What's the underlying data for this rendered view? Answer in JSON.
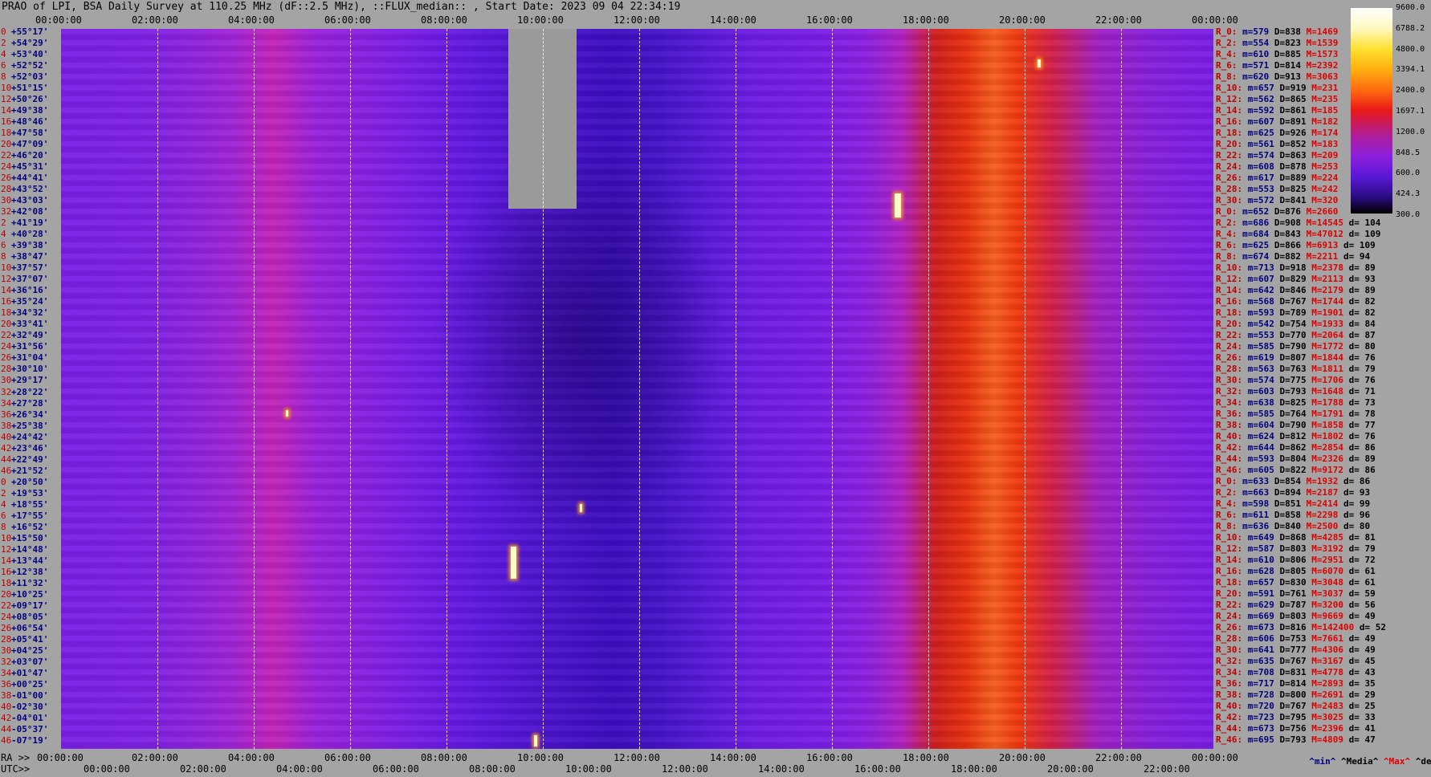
{
  "title": "PRAO of LPI, BSA Daily Survey at 110.25 MHz (dF::2.5 MHz), ::FLUX_median:: , Start Date: 2023 09 04 22:34:19",
  "top_axis": [
    "00:00:00",
    "02:00:00",
    "04:00:00",
    "06:00:00",
    "08:00:00",
    "10:00:00",
    "12:00:00",
    "14:00:00",
    "16:00:00",
    "18:00:00",
    "20:00:00",
    "22:00:00",
    "00:00:00"
  ],
  "ra_axis": {
    "prefix": "RA >>",
    "labels": [
      "00:00:00",
      "02:00:00",
      "04:00:00",
      "06:00:00",
      "08:00:00",
      "10:00:00",
      "12:00:00",
      "14:00:00",
      "16:00:00",
      "18:00:00",
      "20:00:00",
      "22:00:00",
      "00:00:00"
    ]
  },
  "utc_axis": {
    "prefix": "UTC>>",
    "labels": [
      "00:00:00",
      "02:00:00",
      "04:00:00",
      "06:00:00",
      "08:00:00",
      "10:00:00",
      "12:00:00",
      "14:00:00",
      "16:00:00",
      "18:00:00",
      "20:00:00",
      "22:00:00"
    ]
  },
  "colorbar": {
    "labels": [
      "9600.0",
      "6788.2",
      "4800.0",
      "3394.1",
      "2400.0",
      "1697.1",
      "1200.0",
      "848.5",
      "600.0",
      "424.3",
      "300.0"
    ]
  },
  "declinations": [
    {
      "i": "0",
      "dec": "+55°17'"
    },
    {
      "i": "2",
      "dec": "+54°29'"
    },
    {
      "i": "4",
      "dec": "+53°40'"
    },
    {
      "i": "6",
      "dec": "+52°52'"
    },
    {
      "i": "8",
      "dec": "+52°03'"
    },
    {
      "i": "10",
      "dec": "+51°15'"
    },
    {
      "i": "12",
      "dec": "+50°26'"
    },
    {
      "i": "14",
      "dec": "+49°38'"
    },
    {
      "i": "16",
      "dec": "+48°46'"
    },
    {
      "i": "18",
      "dec": "+47°58'"
    },
    {
      "i": "20",
      "dec": "+47°09'"
    },
    {
      "i": "22",
      "dec": "+46°20'"
    },
    {
      "i": "24",
      "dec": "+45°31'"
    },
    {
      "i": "26",
      "dec": "+44°41'"
    },
    {
      "i": "28",
      "dec": "+43°52'"
    },
    {
      "i": "30",
      "dec": "+43°03'"
    },
    {
      "i": "32",
      "dec": "+42°08'"
    },
    {
      "i": "2",
      "dec": "+41°19'"
    },
    {
      "i": "4",
      "dec": "+40°28'"
    },
    {
      "i": "6",
      "dec": "+39°38'"
    },
    {
      "i": "8",
      "dec": "+38°47'"
    },
    {
      "i": "10",
      "dec": "+37°57'"
    },
    {
      "i": "12",
      "dec": "+37°07'"
    },
    {
      "i": "14",
      "dec": "+36°16'"
    },
    {
      "i": "16",
      "dec": "+35°24'"
    },
    {
      "i": "18",
      "dec": "+34°32'"
    },
    {
      "i": "20",
      "dec": "+33°41'"
    },
    {
      "i": "22",
      "dec": "+32°49'"
    },
    {
      "i": "24",
      "dec": "+31°56'"
    },
    {
      "i": "26",
      "dec": "+31°04'"
    },
    {
      "i": "28",
      "dec": "+30°10'"
    },
    {
      "i": "30",
      "dec": "+29°17'"
    },
    {
      "i": "32",
      "dec": "+28°22'"
    },
    {
      "i": "34",
      "dec": "+27°28'"
    },
    {
      "i": "36",
      "dec": "+26°34'"
    },
    {
      "i": "38",
      "dec": "+25°38'"
    },
    {
      "i": "40",
      "dec": "+24°42'"
    },
    {
      "i": "42",
      "dec": "+23°46'"
    },
    {
      "i": "44",
      "dec": "+22°49'"
    },
    {
      "i": "46",
      "dec": "+21°52'"
    },
    {
      "i": "0",
      "dec": "+20°50'"
    },
    {
      "i": "2",
      "dec": "+19°53'"
    },
    {
      "i": "4",
      "dec": "+18°55'"
    },
    {
      "i": "6",
      "dec": "+17°55'"
    },
    {
      "i": "8",
      "dec": "+16°52'"
    },
    {
      "i": "10",
      "dec": "+15°50'"
    },
    {
      "i": "12",
      "dec": "+14°48'"
    },
    {
      "i": "14",
      "dec": "+13°44'"
    },
    {
      "i": "16",
      "dec": "+12°38'"
    },
    {
      "i": "18",
      "dec": "+11°32'"
    },
    {
      "i": "20",
      "dec": "+10°25'"
    },
    {
      "i": "22",
      "dec": "+09°17'"
    },
    {
      "i": "24",
      "dec": "+08°05'"
    },
    {
      "i": "26",
      "dec": "+06°54'"
    },
    {
      "i": "28",
      "dec": "+05°41'"
    },
    {
      "i": "30",
      "dec": "+04°25'"
    },
    {
      "i": "32",
      "dec": "+03°07'"
    },
    {
      "i": "34",
      "dec": "+01°47'"
    },
    {
      "i": "36",
      "dec": "+00°25'"
    },
    {
      "i": "38",
      "dec": "-01°00'"
    },
    {
      "i": "40",
      "dec": "-02°30'"
    },
    {
      "i": "42",
      "dec": "-04°01'"
    },
    {
      "i": "44",
      "dec": "-05°37'"
    },
    {
      "i": "46",
      "dec": "-07°19'"
    }
  ],
  "stats": [
    {
      "r": "R_0:",
      "m": "m=579",
      "d": "D=838",
      "x": "M=1469",
      "dv": ""
    },
    {
      "r": "R_2:",
      "m": "m=554",
      "d": "D=823",
      "x": "M=1539",
      "dv": ""
    },
    {
      "r": "R_4:",
      "m": "m=610",
      "d": "D=885",
      "x": "M=1573",
      "dv": ""
    },
    {
      "r": "R_6:",
      "m": "m=571",
      "d": "D=814",
      "x": "M=2392",
      "dv": ""
    },
    {
      "r": "R_8:",
      "m": "m=620",
      "d": "D=913",
      "x": "M=3063",
      "dv": ""
    },
    {
      "r": "R_10:",
      "m": "m=657",
      "d": "D=919",
      "x": "M=231",
      "dv": ""
    },
    {
      "r": "R_12:",
      "m": "m=562",
      "d": "D=865",
      "x": "M=235",
      "dv": ""
    },
    {
      "r": "R_14:",
      "m": "m=592",
      "d": "D=861",
      "x": "M=185",
      "dv": ""
    },
    {
      "r": "R_16:",
      "m": "m=607",
      "d": "D=891",
      "x": "M=182",
      "dv": ""
    },
    {
      "r": "R_18:",
      "m": "m=625",
      "d": "D=926",
      "x": "M=174",
      "dv": ""
    },
    {
      "r": "R_20:",
      "m": "m=561",
      "d": "D=852",
      "x": "M=183",
      "dv": ""
    },
    {
      "r": "R_22:",
      "m": "m=574",
      "d": "D=863",
      "x": "M=209",
      "dv": ""
    },
    {
      "r": "R_24:",
      "m": "m=608",
      "d": "D=878",
      "x": "M=253",
      "dv": ""
    },
    {
      "r": "R_26:",
      "m": "m=617",
      "d": "D=889",
      "x": "M=224",
      "dv": ""
    },
    {
      "r": "R_28:",
      "m": "m=553",
      "d": "D=825",
      "x": "M=242",
      "dv": ""
    },
    {
      "r": "R_30:",
      "m": "m=572",
      "d": "D=841",
      "x": "M=320",
      "dv": ""
    },
    {
      "r": "R_0:",
      "m": "m=652",
      "d": "D=876",
      "x": "M=2660",
      "dv": ""
    },
    {
      "r": "R_2:",
      "m": "m=686",
      "d": "D=908",
      "x": "M=14545",
      "dv": "d= 104"
    },
    {
      "r": "R_4:",
      "m": "m=684",
      "d": "D=843",
      "x": "M=47012",
      "dv": "d= 109"
    },
    {
      "r": "R_6:",
      "m": "m=625",
      "d": "D=866",
      "x": "M=6913",
      "dv": "d= 109"
    },
    {
      "r": "R_8:",
      "m": "m=674",
      "d": "D=882",
      "x": "M=2211",
      "dv": "d= 94"
    },
    {
      "r": "R_10:",
      "m": "m=713",
      "d": "D=918",
      "x": "M=2378",
      "dv": "d= 89"
    },
    {
      "r": "R_12:",
      "m": "m=607",
      "d": "D=829",
      "x": "M=2113",
      "dv": "d= 93"
    },
    {
      "r": "R_14:",
      "m": "m=642",
      "d": "D=846",
      "x": "M=2179",
      "dv": "d= 89"
    },
    {
      "r": "R_16:",
      "m": "m=568",
      "d": "D=767",
      "x": "M=1744",
      "dv": "d= 82"
    },
    {
      "r": "R_18:",
      "m": "m=593",
      "d": "D=789",
      "x": "M=1901",
      "dv": "d= 82"
    },
    {
      "r": "R_20:",
      "m": "m=542",
      "d": "D=754",
      "x": "M=1933",
      "dv": "d= 84"
    },
    {
      "r": "R_22:",
      "m": "m=553",
      "d": "D=770",
      "x": "M=2064",
      "dv": "d= 87"
    },
    {
      "r": "R_24:",
      "m": "m=585",
      "d": "D=790",
      "x": "M=1772",
      "dv": "d= 80"
    },
    {
      "r": "R_26:",
      "m": "m=619",
      "d": "D=807",
      "x": "M=1844",
      "dv": "d= 76"
    },
    {
      "r": "R_28:",
      "m": "m=563",
      "d": "D=763",
      "x": "M=1811",
      "dv": "d= 79"
    },
    {
      "r": "R_30:",
      "m": "m=574",
      "d": "D=775",
      "x": "M=1706",
      "dv": "d= 76"
    },
    {
      "r": "R_32:",
      "m": "m=603",
      "d": "D=793",
      "x": "M=1648",
      "dv": "d= 71"
    },
    {
      "r": "R_34:",
      "m": "m=638",
      "d": "D=825",
      "x": "M=1788",
      "dv": "d= 73"
    },
    {
      "r": "R_36:",
      "m": "m=585",
      "d": "D=764",
      "x": "M=1791",
      "dv": "d= 78"
    },
    {
      "r": "R_38:",
      "m": "m=604",
      "d": "D=790",
      "x": "M=1858",
      "dv": "d= 77"
    },
    {
      "r": "R_40:",
      "m": "m=624",
      "d": "D=812",
      "x": "M=1802",
      "dv": "d= 76"
    },
    {
      "r": "R_42:",
      "m": "m=644",
      "d": "D=862",
      "x": "M=2854",
      "dv": "d= 86"
    },
    {
      "r": "R_44:",
      "m": "m=593",
      "d": "D=804",
      "x": "M=2326",
      "dv": "d= 89"
    },
    {
      "r": "R_46:",
      "m": "m=605",
      "d": "D=822",
      "x": "M=9172",
      "dv": "d= 86"
    },
    {
      "r": "R_0:",
      "m": "m=633",
      "d": "D=854",
      "x": "M=1932",
      "dv": "d= 86"
    },
    {
      "r": "R_2:",
      "m": "m=663",
      "d": "D=894",
      "x": "M=2187",
      "dv": "d= 93"
    },
    {
      "r": "R_4:",
      "m": "m=598",
      "d": "D=851",
      "x": "M=2414",
      "dv": "d= 99"
    },
    {
      "r": "R_6:",
      "m": "m=611",
      "d": "D=858",
      "x": "M=2298",
      "dv": "d= 96"
    },
    {
      "r": "R_8:",
      "m": "m=636",
      "d": "D=840",
      "x": "M=2500",
      "dv": "d= 80"
    },
    {
      "r": "R_10:",
      "m": "m=649",
      "d": "D=868",
      "x": "M=4285",
      "dv": "d= 81"
    },
    {
      "r": "R_12:",
      "m": "m=587",
      "d": "D=803",
      "x": "M=3192",
      "dv": "d= 79"
    },
    {
      "r": "R_14:",
      "m": "m=610",
      "d": "D=806",
      "x": "M=2951",
      "dv": "d= 72"
    },
    {
      "r": "R_16:",
      "m": "m=628",
      "d": "D=805",
      "x": "M=6070",
      "dv": "d= 61"
    },
    {
      "r": "R_18:",
      "m": "m=657",
      "d": "D=830",
      "x": "M=3048",
      "dv": "d= 61"
    },
    {
      "r": "R_20:",
      "m": "m=591",
      "d": "D=761",
      "x": "M=3037",
      "dv": "d= 59"
    },
    {
      "r": "R_22:",
      "m": "m=629",
      "d": "D=787",
      "x": "M=3200",
      "dv": "d= 56"
    },
    {
      "r": "R_24:",
      "m": "m=669",
      "d": "D=803",
      "x": "M=9669",
      "dv": "d= 49"
    },
    {
      "r": "R_26:",
      "m": "m=673",
      "d": "D=816",
      "x": "M=142400",
      "dv": "d= 52"
    },
    {
      "r": "R_28:",
      "m": "m=606",
      "d": "D=753",
      "x": "M=7661",
      "dv": "d= 49"
    },
    {
      "r": "R_30:",
      "m": "m=641",
      "d": "D=777",
      "x": "M=4306",
      "dv": "d= 49"
    },
    {
      "r": "R_32:",
      "m": "m=635",
      "d": "D=767",
      "x": "M=3167",
      "dv": "d= 45"
    },
    {
      "r": "R_34:",
      "m": "m=708",
      "d": "D=831",
      "x": "M=4778",
      "dv": "d= 43"
    },
    {
      "r": "R_36:",
      "m": "m=717",
      "d": "D=814",
      "x": "M=2893",
      "dv": "d= 35"
    },
    {
      "r": "R_38:",
      "m": "m=728",
      "d": "D=800",
      "x": "M=2691",
      "dv": "d= 29"
    },
    {
      "r": "R_40:",
      "m": "m=720",
      "d": "D=767",
      "x": "M=2483",
      "dv": "d= 25"
    },
    {
      "r": "R_42:",
      "m": "m=723",
      "d": "D=795",
      "x": "M=3025",
      "dv": "d= 33"
    },
    {
      "r": "R_44:",
      "m": "m=673",
      "d": "D=756",
      "x": "M=2396",
      "dv": "d= 41"
    },
    {
      "r": "R_46:",
      "m": "m=695",
      "d": "D=793",
      "x": "M=4809",
      "dv": "d= 47"
    }
  ],
  "stats_footer": {
    "min": "^min^",
    "median": "^Media^",
    "max": "^Max^",
    "devia": "^devia^"
  }
}
